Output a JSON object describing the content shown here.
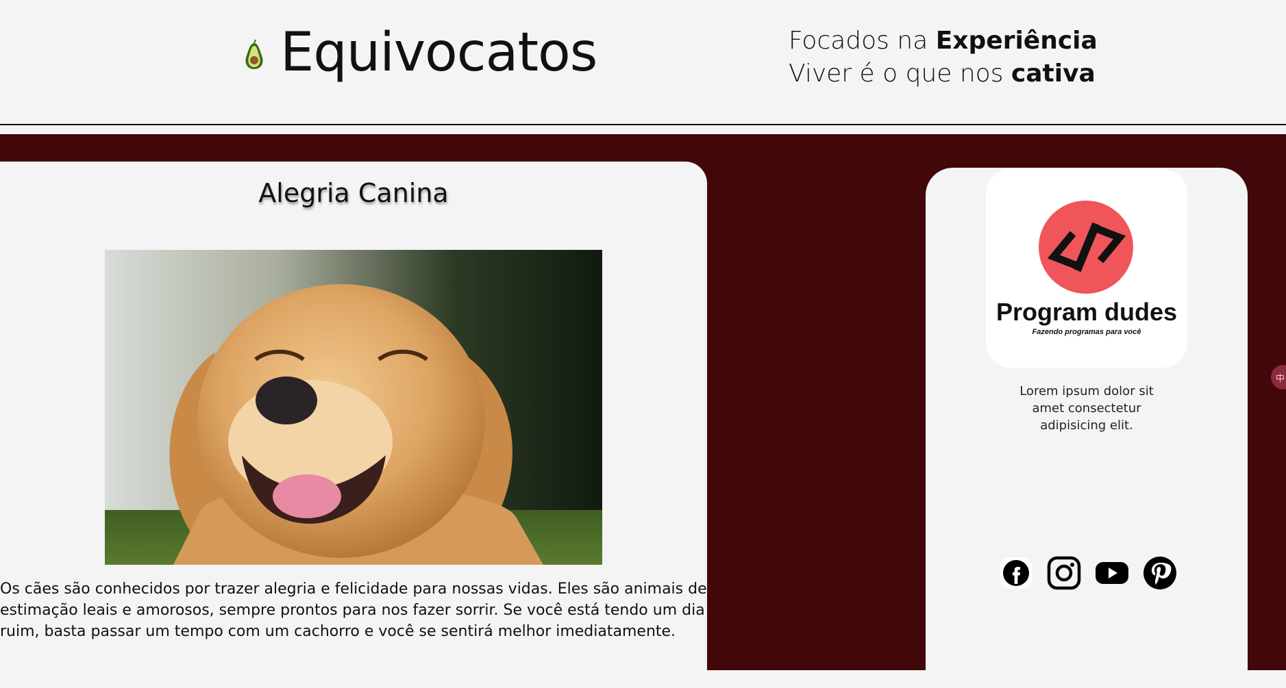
{
  "header": {
    "brand_title": "Equivocatos",
    "tagline_line1_prefix": "Focados na ",
    "tagline_line1_bold": "Experiência",
    "tagline_line2_prefix": "Viver é o que nos ",
    "tagline_line2_bold": "cativa",
    "logo_icon": "avocado-icon"
  },
  "article": {
    "title": "Alegria Canina",
    "image_icon": "golden-retriever-photo",
    "body": "Os cães são conhecidos por trazer alegria e felicidade para nossas vidas. Eles são animais de estimação leais e amorosos, sempre prontos para nos fazer sorrir. Se você está tendo um dia ruim, basta passar um tempo com um cachorro e você se sentirá melhor imediatamente."
  },
  "sidebar": {
    "logo_name": "Program dudes",
    "logo_slogan": "Fazendo programas para você",
    "logo_icon": "code-icon",
    "text": "Lorem ipsum dolor sit amet consectetur adipisicing elit.",
    "socials": [
      {
        "icon": "facebook-icon"
      },
      {
        "icon": "instagram-icon"
      },
      {
        "icon": "youtube-icon"
      },
      {
        "icon": "pinterest-icon"
      }
    ]
  },
  "colors": {
    "background": "#f4f4f4",
    "maroon": "#420708",
    "logo_red": "#f0555a",
    "text": "#111111"
  }
}
